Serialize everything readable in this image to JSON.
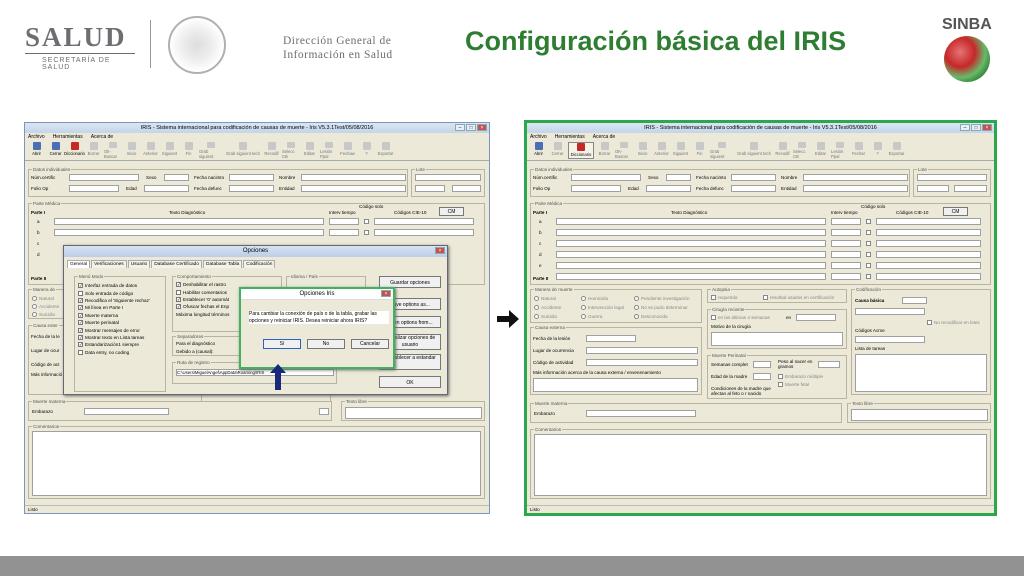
{
  "header": {
    "salud_logo": "SALUD",
    "salud_sub": "SECRETARÍA DE SALUD",
    "dgis_line1": "Dirección General de",
    "dgis_line2": "Información en Salud",
    "slide_title": "Configuración básica del IRIS",
    "sinba_logo": "SINBA"
  },
  "colors": {
    "title_green": "#2e7d32",
    "highlight_border": "#29a84e",
    "footer": "#929292"
  },
  "iris": {
    "title": "IRIS - Sistema internacional para codificación de causas de muerte - Iris V5.3.1Test/05/08/2016",
    "menu": [
      "Archivo",
      "Herramientas",
      "Acerca de"
    ],
    "toolbar": [
      "Abrir",
      "Cerrar",
      "Diccionario",
      "Borrar",
      "Ok-Buscar",
      "Inicio",
      "Anterior",
      "Siguient",
      "Fin",
      "Grab siguient",
      "Grab siguient tech",
      "Recodif",
      "Selecc CB",
      "Editar",
      "Lesión Ppal",
      "Fechaw",
      "?",
      "Exportar"
    ],
    "toolbar_b": [
      "Abrir",
      "Cerrar",
      "Diccionario",
      "Borrar",
      "OK-Buscar",
      "Inicio",
      "Anterior",
      "Siguient",
      "Fin",
      "Grab siguient",
      "Grab siguient tech",
      "Recodif",
      "Selecc CB",
      "Editar",
      "Lesión Ppal",
      "Fechar",
      "?",
      "Exportar"
    ],
    "datos": "Datos individuales",
    "lote": "Lote",
    "num_cert": "Núm.certific",
    "sexo": "Sexo",
    "fecha_nac": "Fecha nacimto",
    "nombre": "Nombre",
    "folio": "Folio Op",
    "edad": "Edad",
    "fecha_def": "Fecha defunc",
    "entidad": "Entidad",
    "parte_medica": "Parte Médica",
    "parte1": "Parte I",
    "texto_diag": "Texto Diagnóstico",
    "interv": "Interv tiempo",
    "codigo_solo": "Código solo",
    "codigos_cie": "Códigos CIE-10",
    "cm": "CM",
    "parte2": "Parte II",
    "rows": [
      "a",
      "b",
      "c",
      "d",
      "e"
    ],
    "manera": "Manera de muerte",
    "natural": "Natural",
    "homicidio": "Homicidio",
    "pendiente": "Pendiente investigación",
    "accidente": "Accidente",
    "interv_legal": "Intervención legal",
    "no_determinar": "No se pudo determinar",
    "suicidio": "Suicidio",
    "guerra": "Guerra",
    "desconocida": "Desconocida",
    "causa_externa": "Causa externa",
    "fecha_lesion": "Fecha de la lesión",
    "lugar": "Lugar de ocurrencia",
    "codigo_act": "Código de actividad",
    "mas_info": "Más información acerca de la causa externa / envenenamiento",
    "autopsia": "Autopsia",
    "requerida": "requerida",
    "resultado": "resultad usados en certificación",
    "cirugia": "Cirugía reciente",
    "ultimas": "en las últimas 4 semanas",
    "en": "en",
    "motivo": "Motivo de la cirugía",
    "perinatal": "Muerte Perinatal",
    "semanas": "Semanas complet",
    "peso": "Peso al nacer en gramos",
    "edad_madre": "Edad de la madre",
    "embarazo_mult": "Embarazo múltiple",
    "muerte_fetal": "Muerte fetal",
    "condiciones": "Condiciones de la madre que afectan al feto o r nacido",
    "codificacion": "Codificación",
    "causa_basica": "Causa básica",
    "no_recod": "No recodificar en lotes",
    "codigos_acme": "Códigos Acme",
    "lista_tareas": "Lista de tareas",
    "materna": "Muerte materna",
    "embarazo": "Embarazo",
    "texto_libre": "Texto libre",
    "comentarios": "Comentarios",
    "status": "Listo"
  },
  "opciones": {
    "title": "Opciones",
    "tabs": [
      "General",
      "Verificaciones",
      "Usuario",
      "Database Certificado",
      "Database Tabla",
      "Codificación"
    ],
    "menu_modo": "Menú Modo",
    "modo_items": [
      "Interfaz entrada de datos",
      "Solo entrada de código",
      "Recodifica el 'Siguiente rechaz'",
      "Mi línea en Parte I",
      "Muerte materna",
      "Muerte perinatal",
      "Mostrar mensajes de error",
      "Mostrar texto en Lista tareas",
      "Estandarización1 siempre",
      "Data entry, no coding"
    ],
    "comportamiento": "Comportamiento",
    "comp_items": [
      "Deshabilitar el rastro",
      "Habilitar comentarios",
      "Establecer '0' automát",
      "Ofuscar fechas el Enp",
      "Máxima longitud términos"
    ],
    "separadores": "Separadores",
    "para_diag": "Para el diagnóstico",
    "gebido": "Gebido a (causal):",
    "ruta": "Ruta de registro",
    "ruta_val": "C:\\Users\\MiguelAngel\\AppData\\Roaming\\IRIS",
    "idioma": "Idioma / País",
    "guardar": "Guardar opciones",
    "save_opts": "Save options as...",
    "open_opts": "Open options from...",
    "actualizar": "Actualizar opciones de usuario",
    "restablecer": "Restablecer a estandar",
    "ok": "OK"
  },
  "confirm": {
    "title": "Opciones Iris",
    "message": "Para cambiar la conexión de país o de la tabla, grabar las opciones y reiniciar IRIS. Desea reiniciar ahora IRIS?",
    "si": "Sí",
    "no": "No",
    "cancelar": "Cancelar"
  }
}
